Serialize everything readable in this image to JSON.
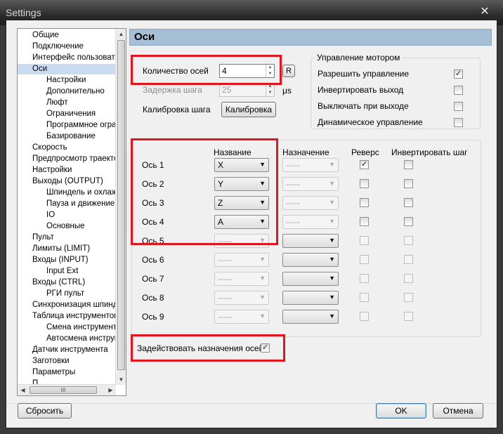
{
  "window": {
    "title": "Settings",
    "close_glyph": "✕"
  },
  "tree": {
    "items": [
      {
        "label": "Общие",
        "indent": 1
      },
      {
        "label": "Подключение",
        "indent": 1
      },
      {
        "label": "Интерфейс пользовате",
        "indent": 1
      },
      {
        "label": "Оси",
        "indent": 1,
        "selected": true
      },
      {
        "label": "Настройки",
        "indent": 2
      },
      {
        "label": "Дополнительно",
        "indent": 2
      },
      {
        "label": "Люфт",
        "indent": 2
      },
      {
        "label": "Ограничения",
        "indent": 2
      },
      {
        "label": "Программное огра",
        "indent": 2
      },
      {
        "label": "Базирование",
        "indent": 2
      },
      {
        "label": "Скорость",
        "indent": 1
      },
      {
        "label": "Предпросмотр траекто",
        "indent": 1
      },
      {
        "label": "Настройки",
        "indent": 1
      },
      {
        "label": "Выходы (OUTPUT)",
        "indent": 1
      },
      {
        "label": "Шпиндель и охлажд",
        "indent": 2
      },
      {
        "label": "Пауза и движение",
        "indent": 2
      },
      {
        "label": "IO",
        "indent": 2
      },
      {
        "label": "Основные",
        "indent": 2
      },
      {
        "label": "Пульт",
        "indent": 1
      },
      {
        "label": "Лимиты (LIMIT)",
        "indent": 1
      },
      {
        "label": "Входы (INPUT)",
        "indent": 1
      },
      {
        "label": "Input Ext",
        "indent": 2
      },
      {
        "label": "Входы (CTRL)",
        "indent": 1
      },
      {
        "label": "РГИ пульт",
        "indent": 2
      },
      {
        "label": "Синхронизация шпинде",
        "indent": 1
      },
      {
        "label": "Таблица инструментов",
        "indent": 1
      },
      {
        "label": "Смена инструмента",
        "indent": 2
      },
      {
        "label": "Автосмена инструм",
        "indent": 2
      },
      {
        "label": "Датчик инструмента",
        "indent": 1
      },
      {
        "label": "Заготовки",
        "indent": 1
      },
      {
        "label": "Параметры",
        "indent": 1
      },
      {
        "label": "П...",
        "indent": 1
      }
    ],
    "hscroll_grip": "III"
  },
  "page_title": "Оси",
  "axes_count": {
    "label": "Количество осей",
    "value": "4",
    "r_button": "R"
  },
  "step_delay": {
    "label": "Задержка шага",
    "value": "25",
    "unit": "μs"
  },
  "calibration": {
    "label": "Калибровка шага",
    "button": "Калибровка"
  },
  "motor": {
    "title": "Управление мотором",
    "options": [
      {
        "label": "Разрешить управление",
        "checked": true
      },
      {
        "label": "Инвертировать выход",
        "checked": false
      },
      {
        "label": "Выключать при выходе",
        "checked": false
      },
      {
        "label": "Динамическое управление",
        "checked": false
      }
    ]
  },
  "axes_table": {
    "headers": {
      "name": "Название",
      "assign": "Назначение",
      "reverse": "Реверс",
      "invert": "Инвертировать шаг"
    },
    "rows": [
      {
        "label": "Ось 1",
        "name": "X",
        "assign": "-----",
        "reverse": true,
        "invert": false
      },
      {
        "label": "Ось 2",
        "name": "Y",
        "assign": "-----",
        "reverse": false,
        "invert": false
      },
      {
        "label": "Ось 3",
        "name": "Z",
        "assign": "-----",
        "reverse": false,
        "invert": false
      },
      {
        "label": "Ось 4",
        "name": "A",
        "assign": "-----",
        "reverse": false,
        "invert": false
      },
      {
        "label": "Ось 5",
        "name": "-----",
        "assign": "",
        "reverse": false,
        "invert": false
      },
      {
        "label": "Ось 6",
        "name": "-----",
        "assign": "",
        "reverse": false,
        "invert": false
      },
      {
        "label": "Ось 7",
        "name": "-----",
        "assign": "",
        "reverse": false,
        "invert": false
      },
      {
        "label": "Ось 8",
        "name": "-----",
        "assign": "",
        "reverse": false,
        "invert": false
      },
      {
        "label": "Ось 9",
        "name": "-----",
        "assign": "",
        "reverse": false,
        "invert": false
      }
    ]
  },
  "use_assignments": {
    "label": "Задействовать назначения осей",
    "checked": true
  },
  "footer": {
    "reset": "Сбросить",
    "ok": "OK",
    "cancel": "Отмена"
  },
  "colors": {
    "highlight": "#e2141d",
    "header_bg": "#a7bfd6",
    "selection": "#c9dcef"
  }
}
